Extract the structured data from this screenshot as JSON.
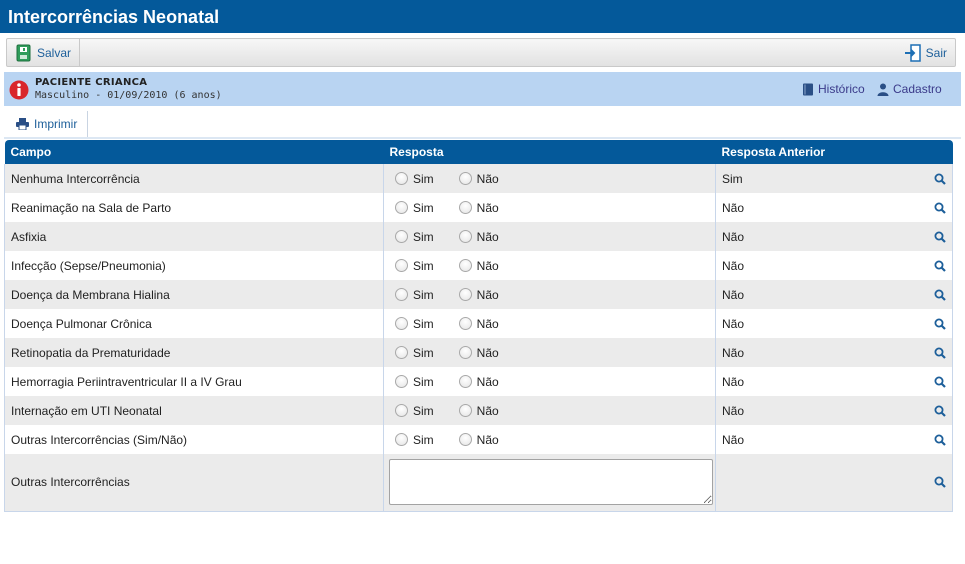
{
  "window": {
    "title": "Intercorrências Neonatal"
  },
  "toolbar": {
    "save_label": "Salvar",
    "exit_label": "Sair"
  },
  "patient": {
    "name": "PACIENTE CRIANCA",
    "details": "Masculino - 01/09/2010 (6 anos)",
    "history_label": "Histórico",
    "register_label": "Cadastro"
  },
  "actions": {
    "print_label": "Imprimir"
  },
  "table": {
    "headers": {
      "field": "Campo",
      "answer": "Resposta",
      "previous": "Resposta Anterior"
    },
    "option_yes": "Sim",
    "option_no": "Não",
    "rows": [
      {
        "field": "Nenhuma Intercorrência",
        "previous": "Sim"
      },
      {
        "field": "Reanimação na Sala de Parto",
        "previous": "Não"
      },
      {
        "field": "Asfixia",
        "previous": "Não"
      },
      {
        "field": "Infecção (Sepse/Pneumonia)",
        "previous": "Não"
      },
      {
        "field": "Doença da Membrana Hialina",
        "previous": "Não"
      },
      {
        "field": "Doença Pulmonar Crônica",
        "previous": "Não"
      },
      {
        "field": "Retinopatia da Prematuridade",
        "previous": "Não"
      },
      {
        "field": "Hemorragia Periintraventricular II a IV Grau",
        "previous": "Não"
      },
      {
        "field": "Internação em UTI Neonatal",
        "previous": "Não"
      },
      {
        "field": "Outras Intercorrências (Sim/Não)",
        "previous": "Não"
      }
    ],
    "text_row": {
      "field": "Outras Intercorrências",
      "value": "",
      "previous": ""
    }
  },
  "icons": {
    "save": "save-icon",
    "exit": "exit-icon",
    "info": "info-icon",
    "history": "book-icon",
    "register": "user-icon",
    "print": "printer-icon",
    "search": "magnifier-icon"
  },
  "colors": {
    "header": "#04599a",
    "patient_bar": "#b9d4f2",
    "row_alt": "#ebebeb",
    "link": "#1d5f9a",
    "alert": "#d9262c"
  }
}
